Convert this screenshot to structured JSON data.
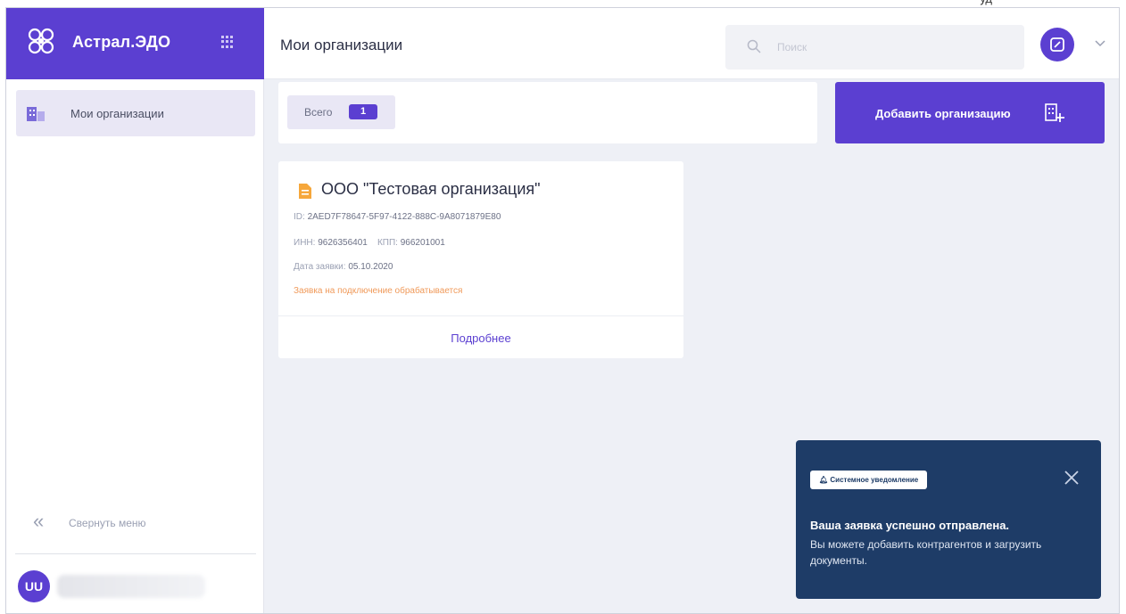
{
  "top_fragment": "уд",
  "brand": {
    "name": "Астрал.ЭДО",
    "logo_icon": "astral-logo-icon",
    "apps_icon": "apps-grid-icon",
    "color": "#5b3fd1"
  },
  "sidebar": {
    "items": [
      {
        "label": "Мои организации",
        "icon": "building-icon"
      }
    ],
    "collapse_label": "Свернуть меню",
    "user": {
      "initials": "UU"
    }
  },
  "header": {
    "title": "Мои организации",
    "search_placeholder": "Поиск",
    "profile_icon": "profile-icon"
  },
  "toolbar": {
    "total_label": "Всего",
    "total_count": "1",
    "add_button_label": "Добавить организацию"
  },
  "organization": {
    "name": "ООО \"Тестовая организация\"",
    "id_label": "ID:",
    "id_value": "2AED7F78647-5F97-4122-888C-9A8071879E80",
    "inn_label": "ИНН:",
    "inn_value": "9626356401",
    "kpp_label": "КПП:",
    "kpp_value": "966201001",
    "date_label": "Дата заявки:",
    "date_value": "05.10.2020",
    "status": "Заявка на подключение обрабатывается",
    "more_label": "Подробнее"
  },
  "toast": {
    "badge": "Системное уведомление",
    "title": "Ваша заявка успешно отправлена.",
    "body": "Вы можете добавить контрагентов и загрузить документы."
  }
}
